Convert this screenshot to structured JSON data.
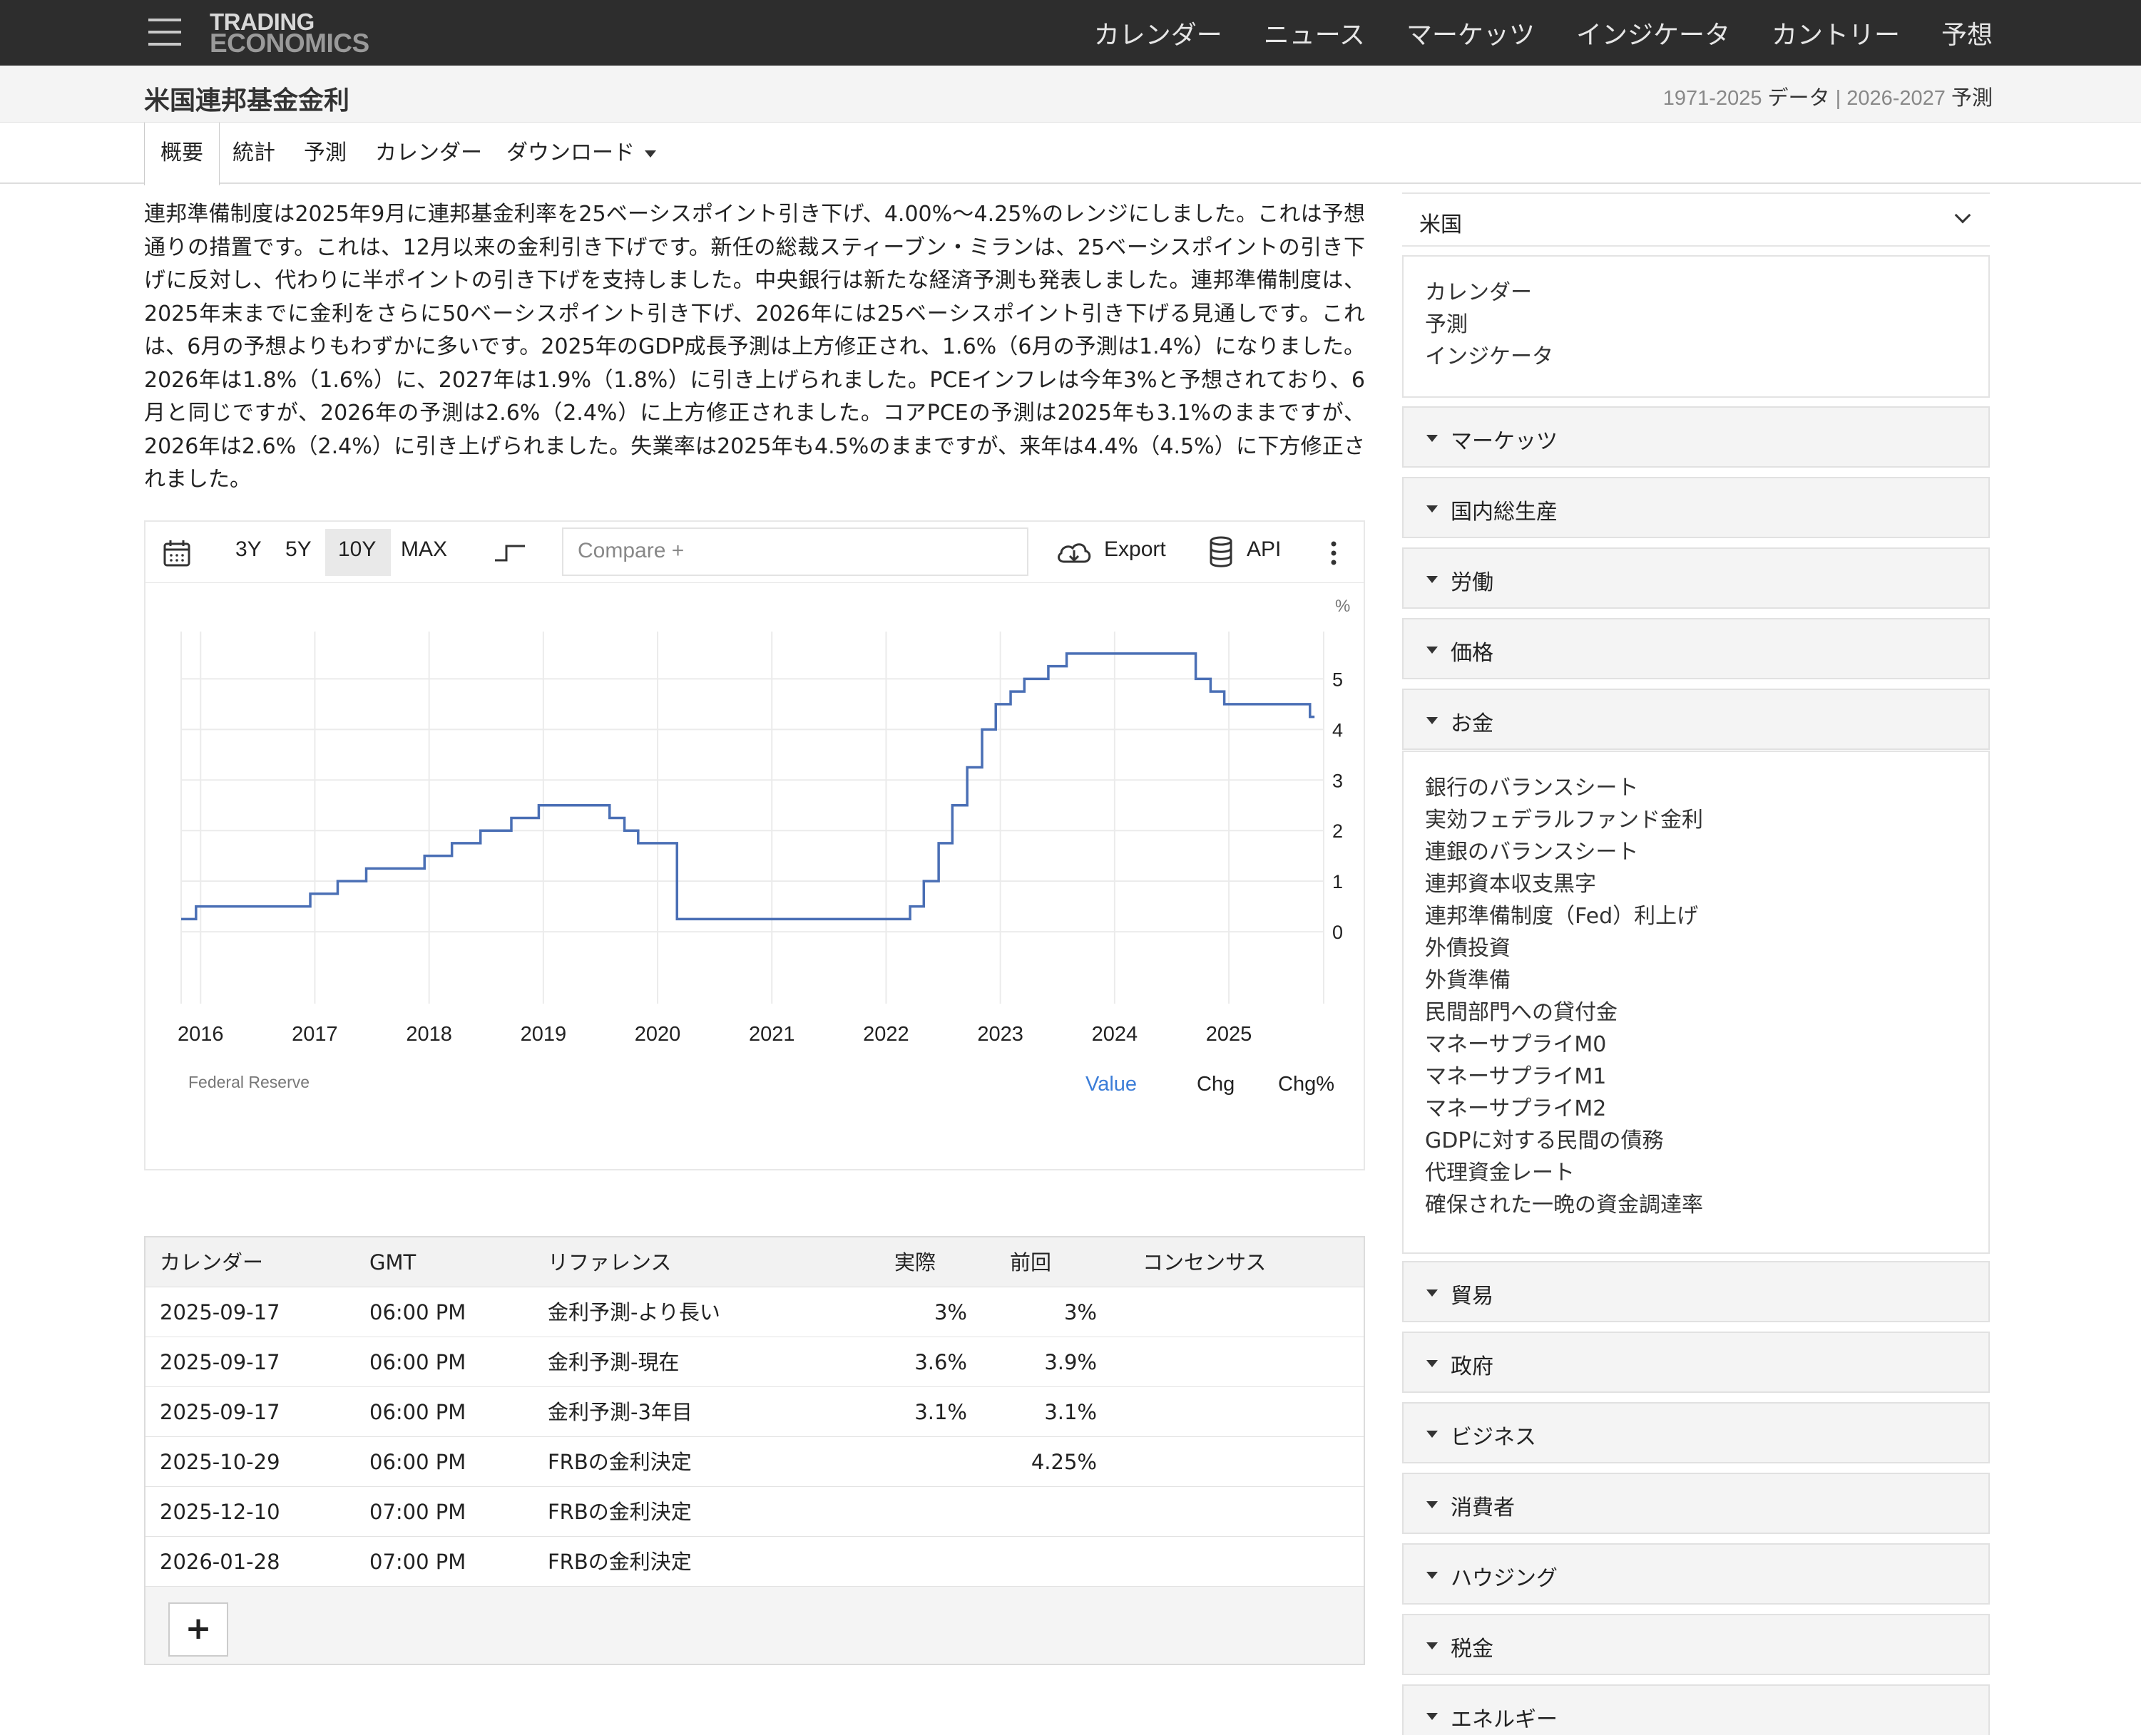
{
  "header": {
    "logo_line1": "TRADING",
    "logo_line2": "ECONOMICS",
    "nav": [
      "カレンダー",
      "ニュース",
      "マーケッツ",
      "インジケータ",
      "カントリー",
      "予想"
    ]
  },
  "title": {
    "page_title": "米国連邦基金金利",
    "data_years": "1971-2025",
    "data_label": "データ",
    "separator": "|",
    "forecast_years": "2026-2027",
    "forecast_label": "予測"
  },
  "tabs": [
    "概要",
    "統計",
    "予測",
    "カレンダー",
    "ダウンロード"
  ],
  "description": "連邦準備制度は2025年9月に連邦基金利率を25ベーシスポイント引き下げ、4.00%〜4.25%のレンジにしました。これは予想通りの措置です。これは、12月以来の金利引き下げです。新任の総裁スティーブン・ミランは、25ベーシスポイントの引き下げに反対し、代わりに半ポイントの引き下げを支持しました。中央銀行は新たな経済予測も発表しました。連邦準備制度は、2025年末までに金利をさらに50ベーシスポイント引き下げ、2026年には25ベーシスポイント引き下げる見通しです。これは、6月の予想よりもわずかに多いです。2025年のGDP成長予測は上方修正され、1.6%（6月の予測は1.4%）になりました。2026年は1.8%（1.6%）に、2027年は1.9%（1.8%）に引き上げられました。PCEインフレは今年3%と予想されており、6月と同じですが、2026年の予測は2.6%（2.4%）に上方修正されました。コアPCEの予測は2025年も3.1%のままですが、2026年は2.6%（2.4%）に引き上げられました。失業率は2025年も4.5%のままですが、来年は4.4%（4.5%）に下方修正されました。",
  "chart_toolbar": {
    "ranges": [
      "3Y",
      "5Y",
      "10Y",
      "MAX"
    ],
    "selected_range": "10Y",
    "compare_placeholder": "Compare +",
    "export": "Export",
    "api": "API"
  },
  "chart_data": {
    "type": "line",
    "step": true,
    "ylabel": "%",
    "xlabel": "",
    "source": "Federal Reserve",
    "xticks": [
      "2016",
      "2017",
      "2018",
      "2019",
      "2020",
      "2021",
      "2022",
      "2023",
      "2024",
      "2025"
    ],
    "yticks": [
      0,
      1,
      2,
      3,
      4,
      5
    ],
    "xlim": [
      2015.83,
      2025.83
    ],
    "ylim": [
      -1,
      6.5
    ],
    "grid": true,
    "series": [
      {
        "color": "#4a6fb5",
        "points": [
          [
            2015.83,
            0.25
          ],
          [
            2015.96,
            0.5
          ],
          [
            2016.96,
            0.75
          ],
          [
            2017.2,
            1.0
          ],
          [
            2017.45,
            1.25
          ],
          [
            2017.96,
            1.5
          ],
          [
            2018.2,
            1.75
          ],
          [
            2018.45,
            2.0
          ],
          [
            2018.72,
            2.25
          ],
          [
            2018.96,
            2.5
          ],
          [
            2019.58,
            2.25
          ],
          [
            2019.71,
            2.0
          ],
          [
            2019.83,
            1.75
          ],
          [
            2020.17,
            0.25
          ],
          [
            2022.21,
            0.5
          ],
          [
            2022.33,
            1.0
          ],
          [
            2022.46,
            1.75
          ],
          [
            2022.58,
            2.5
          ],
          [
            2022.71,
            3.25
          ],
          [
            2022.84,
            4.0
          ],
          [
            2022.96,
            4.5
          ],
          [
            2023.09,
            4.75
          ],
          [
            2023.21,
            5.0
          ],
          [
            2023.42,
            5.25
          ],
          [
            2023.58,
            5.5
          ],
          [
            2024.71,
            5.0
          ],
          [
            2024.84,
            4.75
          ],
          [
            2024.96,
            4.5
          ],
          [
            2025.71,
            4.25
          ],
          [
            2025.75,
            4.25
          ]
        ]
      }
    ],
    "value_modes": [
      "Value",
      "Chg",
      "Chg%"
    ],
    "selected_mode": "Value"
  },
  "calendar": {
    "headers": [
      "カレンダー",
      "GMT",
      "リファレンス",
      "実際",
      "前回",
      "コンセンサス"
    ],
    "rows": [
      [
        "2025-09-17",
        "06:00 PM",
        "金利予測-より長い",
        "3%",
        "3%",
        ""
      ],
      [
        "2025-09-17",
        "06:00 PM",
        "金利予測-現在",
        "3.6%",
        "3.9%",
        ""
      ],
      [
        "2025-09-17",
        "06:00 PM",
        "金利予測-3年目",
        "3.1%",
        "3.1%",
        ""
      ],
      [
        "2025-10-29",
        "06:00 PM",
        "FRBの金利決定",
        "",
        "4.25%",
        ""
      ],
      [
        "2025-12-10",
        "07:00 PM",
        "FRBの金利決定",
        "",
        "",
        ""
      ],
      [
        "2026-01-28",
        "07:00 PM",
        "FRBの金利決定",
        "",
        "",
        ""
      ]
    ],
    "add_label": "+"
  },
  "sidebar": {
    "country": "米国",
    "top_links": [
      "カレンダー",
      "予測",
      "インジケータ"
    ],
    "sections": [
      "マーケッツ",
      "国内総生産",
      "労働",
      "価格",
      "お金",
      "貿易",
      "政府",
      "ビジネス",
      "消費者",
      "ハウジング",
      "税金",
      "エネルギー"
    ],
    "money_links": [
      "銀行のバランスシート",
      "実効フェデラルファンド金利",
      "連銀のバランスシート",
      "連邦資本収支黒字",
      "連邦準備制度（Fed）利上げ",
      "外債投資",
      "外貨準備",
      "民間部門への貸付金",
      "マネーサプライM0",
      "マネーサプライM1",
      "マネーサプライM2",
      "GDPに対する民間の債務",
      "代理資金レート",
      "確保された一晩の資金調達率"
    ]
  },
  "colors": {
    "navbar": "#2d2d2d",
    "series_line": "#4a6fb5",
    "selected_mode": "#3b7dd8"
  }
}
